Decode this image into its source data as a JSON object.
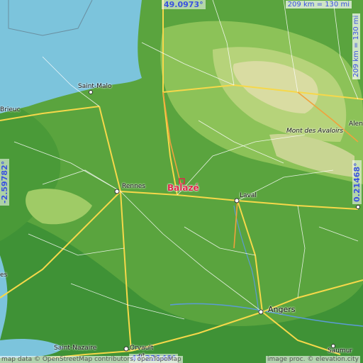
{
  "coords": {
    "top": "49.0973°",
    "bottom": "47.22149°",
    "left": "-2.59782°",
    "right": "0.21468°"
  },
  "scale": {
    "horizontal": "209 km = 130 mi",
    "vertical": "209 km = 130 mi"
  },
  "target": {
    "name": "Balazé"
  },
  "cities": [
    {
      "name": "Saint-Malo",
      "key": "saint-malo"
    },
    {
      "name": "Brieuc",
      "key": "saint-brieuc"
    },
    {
      "name": "Rennes",
      "key": "rennes"
    },
    {
      "name": "Laval",
      "key": "laval"
    },
    {
      "name": "Angers",
      "key": "angers"
    },
    {
      "name": "Saint-Nazaire",
      "key": "saint-nazaire"
    },
    {
      "name": "Orvault",
      "key": "orvault"
    },
    {
      "name": "Saumur",
      "key": "saumur"
    },
    {
      "name": "Alen",
      "key": "alencon"
    },
    {
      "name": "Mont des Avaloirs",
      "key": "mont-des-avaloirs"
    },
    {
      "name": "nt",
      "key": "nantes"
    },
    {
      "name": "es",
      "key": "vannes"
    }
  ],
  "credits": {
    "left": "map data © OpenStreetMap contributors, openTopoMap",
    "right": "image proc. © elevation.city"
  },
  "colors": {
    "sea": "#7cc4dc",
    "lowland": "#4f9e3a",
    "midland": "#8fc45a",
    "highland": "#d4d9a0",
    "road_major": "#f6d84a",
    "road_minor": "#ffffff",
    "target": "#e0284a",
    "coord_text": "#3a52e0"
  }
}
